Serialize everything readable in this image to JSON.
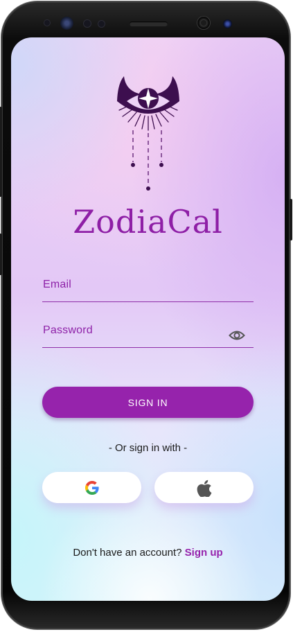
{
  "app": {
    "title": "ZodiaCal"
  },
  "login": {
    "email_label": "Email",
    "password_label": "Password",
    "sign_in_label": "SIGN IN",
    "or_text": "- Or sign in with -",
    "no_account_text": "Don't have an account?",
    "sign_up_label": "Sign up"
  },
  "icons": {
    "logo": "eye-moon-logo-icon",
    "password_toggle": "eye-icon",
    "google": "google-icon",
    "apple": "apple-icon"
  },
  "colors": {
    "accent": "#9623ac",
    "title": "#8e1fa6",
    "logo": "#3d0f4f"
  }
}
